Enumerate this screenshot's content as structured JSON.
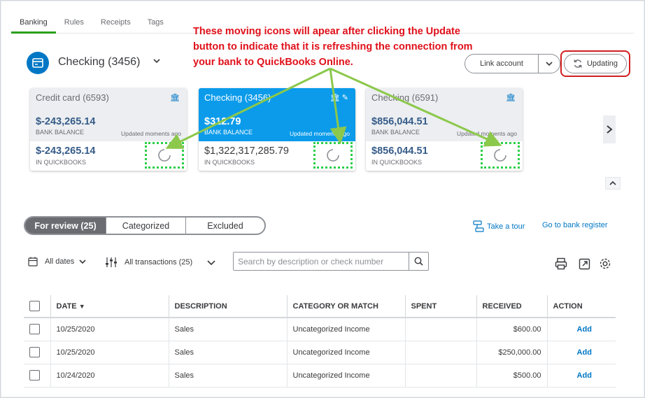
{
  "tabs": [
    "Banking",
    "Rules",
    "Receipts",
    "Tags"
  ],
  "account": {
    "title": "Checking (3456)"
  },
  "annotation": "These moving icons will apear after clicking the Update button to indicate that it is refreshing the connection from your bank to QuickBooks Online.",
  "header_actions": {
    "link_account": "Link account",
    "updating": "Updating"
  },
  "cards": [
    {
      "name": "Credit card (6593)",
      "bank_balance": "$-243,265.14",
      "bank_balance_label": "BANK BALANCE",
      "updated": "Updated moments ago",
      "qb_balance": "$-243,265.14",
      "qb_label": "IN QUICKBOOKS"
    },
    {
      "name": "Checking (3456)",
      "bank_balance": "$312.79",
      "bank_balance_label": "BANK BALANCE",
      "updated": "Updated moments ago",
      "qb_balance": "$1,322,317,285.79",
      "qb_label": "IN QUICKBOOKS"
    },
    {
      "name": "Checking (6591)",
      "bank_balance": "$856,044.51",
      "bank_balance_label": "BANK BALANCE",
      "updated": "Updated moments ago",
      "qb_balance": "$856,044.51",
      "qb_label": "IN QUICKBOOKS"
    }
  ],
  "segments": [
    "For review (25)",
    "Categorized",
    "Excluded"
  ],
  "links": {
    "tour": "Take a tour",
    "register": "Go to bank register"
  },
  "filters": {
    "dates": "All dates",
    "transactions": "All transactions (25)",
    "search_placeholder": "Search by description or check number"
  },
  "table": {
    "headers": [
      "DATE",
      "DESCRIPTION",
      "CATEGORY OR MATCH",
      "SPENT",
      "RECEIVED",
      "ACTION"
    ],
    "sort_indicator": "▼",
    "rows": [
      {
        "date": "10/25/2020",
        "description": "Sales",
        "category": "Uncategorized Income",
        "spent": "",
        "received": "$600.00",
        "action": "Add"
      },
      {
        "date": "10/25/2020",
        "description": "Sales",
        "category": "Uncategorized Income",
        "spent": "",
        "received": "$250,000.00",
        "action": "Add"
      },
      {
        "date": "10/24/2020",
        "description": "Sales",
        "category": "Uncategorized Income",
        "spent": "",
        "received": "$500.00",
        "action": "Add"
      }
    ]
  },
  "colors": {
    "accent_green": "#2ca01c",
    "selected_card": "#0b9bea",
    "annotation_red": "#e0101a",
    "highlight_green": "#2ccf47",
    "link_blue": "#0077c5"
  }
}
